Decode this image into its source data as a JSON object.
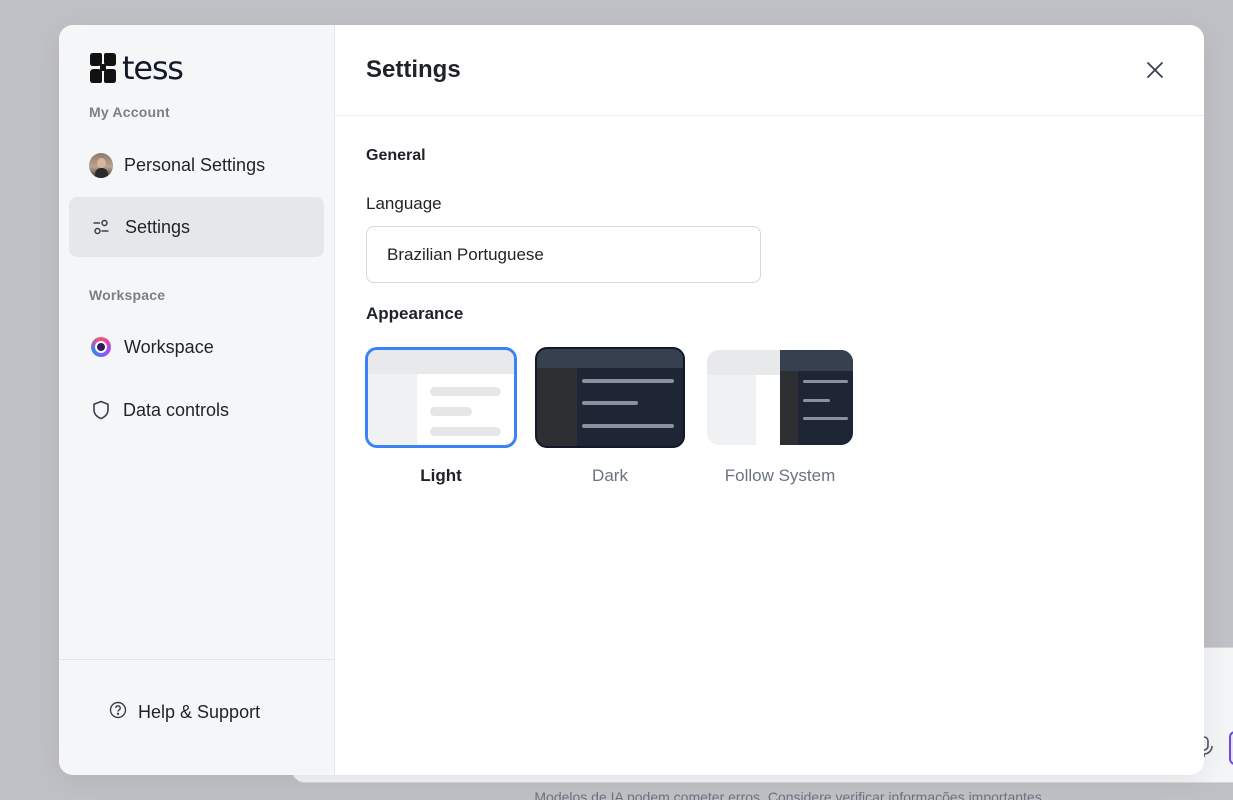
{
  "background": {
    "disclaimer": "Modelos de IA podem cometer erros. Considere verificar informações importantes."
  },
  "sidebar": {
    "logo_text": "tess",
    "my_account_label": "My Account",
    "items": [
      {
        "label": "Personal Settings",
        "icon": "avatar"
      },
      {
        "label": "Settings",
        "icon": "sliders-icon"
      }
    ],
    "workspace_label": "Workspace",
    "workspace_items": [
      {
        "label": "Workspace",
        "icon": "workspace-icon"
      },
      {
        "label": "Data controls",
        "icon": "shield-icon"
      }
    ],
    "help_label": "Help & Support"
  },
  "main": {
    "title": "Settings",
    "general_label": "General",
    "language_label": "Language",
    "language_value": "Brazilian Portuguese",
    "appearance_label": "Appearance",
    "themes": [
      {
        "label": "Light",
        "selected": true
      },
      {
        "label": "Dark",
        "selected": false
      },
      {
        "label": "Follow System",
        "selected": false
      }
    ]
  },
  "colors": {
    "accent": "#3b82f6",
    "dark_theme_bg": "#1e2636",
    "sidebar_bg": "#f5f6f8",
    "active_item_bg": "#e6e7ea"
  }
}
